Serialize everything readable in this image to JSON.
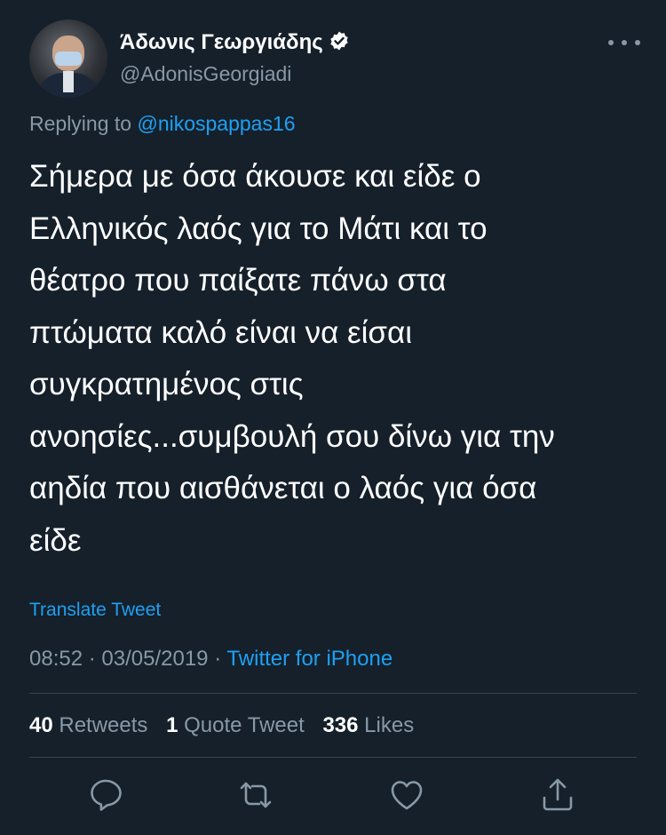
{
  "author": {
    "display_name": "Άδωνις Γεωργιάδης",
    "handle": "@AdonisGeorgiadi",
    "verified": true
  },
  "reply": {
    "prefix": "Replying to",
    "mention": "@nikospappas16"
  },
  "tweet": {
    "lines": [
      "Σήμερα με όσα άκουσε και είδε ο",
      "Ελληνικός λαός για το Μάτι και το",
      "θέατρο που παίξατε πάνω στα",
      "πτώματα καλό είναι να είσαι",
      "συγκρατημένος στις",
      "ανοησίες...συμβουλή σου δίνω για την",
      "αηδία που αισθάνεται ο λαός για όσα",
      "είδε"
    ]
  },
  "translate_label": "Translate Tweet",
  "meta": {
    "time": "08:52",
    "date": "03/05/2019",
    "separator": "·",
    "source": "Twitter for iPhone"
  },
  "stats": {
    "retweets_count": "40",
    "retweets_label": "Retweets",
    "quotes_count": "1",
    "quotes_label": "Quote Tweet",
    "likes_count": "336",
    "likes_label": "Likes"
  },
  "actions": {
    "icons": [
      "reply-icon",
      "retweet-icon",
      "like-icon",
      "share-icon"
    ]
  },
  "colors": {
    "background": "#15202b",
    "text": "#ffffff",
    "muted": "#8899a6",
    "accent": "#1da1f2",
    "divider": "#38444d"
  }
}
